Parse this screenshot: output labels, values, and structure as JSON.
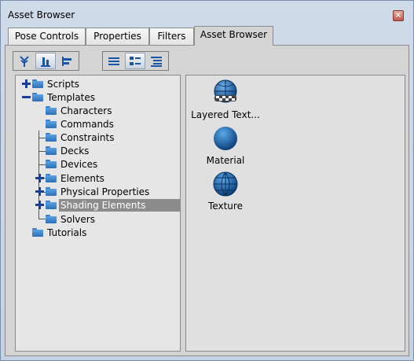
{
  "window": {
    "title": "Asset Browser",
    "close_symbol": "×"
  },
  "tabs": [
    {
      "label": "Pose Controls"
    },
    {
      "label": "Properties"
    },
    {
      "label": "Filters"
    },
    {
      "label": "Asset Browser",
      "active": true
    }
  ],
  "toolbar": {
    "view_group_1": [
      "tree-icon",
      "bottom-align-icon",
      "left-align-icon"
    ],
    "view_group_2": [
      "list-icon",
      "thumbnail-list-icon",
      "detail-list-icon"
    ]
  },
  "tree": {
    "items": [
      {
        "label": "Scripts",
        "expander": "plus"
      },
      {
        "label": "Templates",
        "expander": "minus"
      },
      {
        "label": "Characters"
      },
      {
        "label": "Commands"
      },
      {
        "label": "Constraints"
      },
      {
        "label": "Decks"
      },
      {
        "label": "Devices"
      },
      {
        "label": "Elements",
        "expander": "plus"
      },
      {
        "label": "Physical Properties",
        "expander": "plus"
      },
      {
        "label": "Shading Elements",
        "expander": "plus",
        "selected": true
      },
      {
        "label": "Solvers"
      },
      {
        "label": "Tutorials"
      }
    ]
  },
  "assets": {
    "items": [
      {
        "label": "Layered Text...",
        "icon": "layered-texture-icon"
      },
      {
        "label": "Material",
        "icon": "material-sphere-icon"
      },
      {
        "label": "Texture",
        "icon": "texture-sphere-icon"
      }
    ]
  },
  "colors": {
    "selection": "#8c8c8c",
    "expander": "#1a3f9a",
    "folder": "#3a7fc8",
    "sphere": "#1f6fb8"
  }
}
